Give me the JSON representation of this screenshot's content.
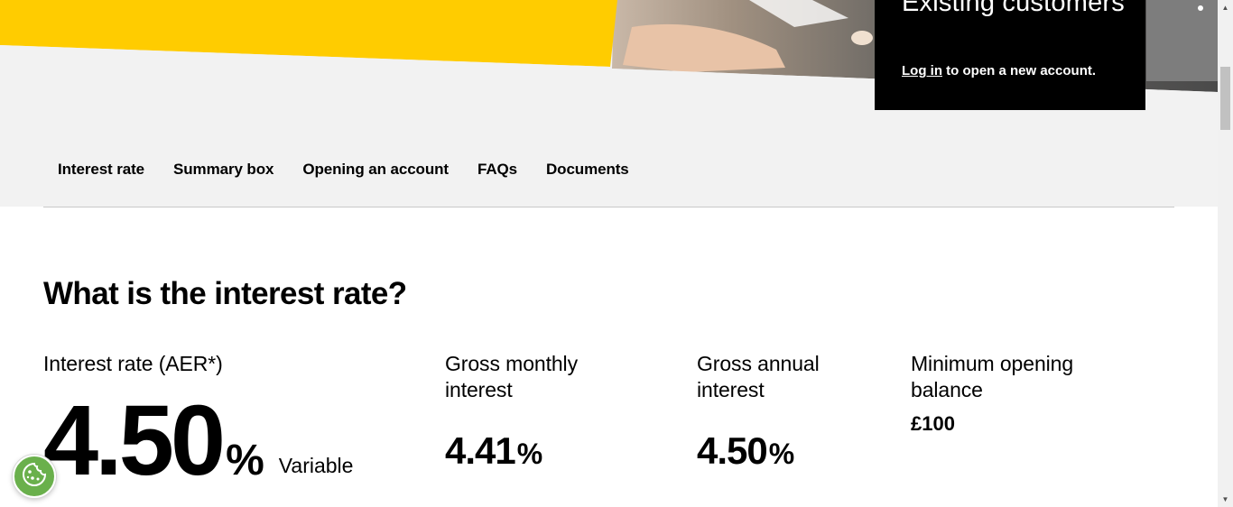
{
  "hero": {
    "existing_title": "Existing customers",
    "login_link": "Log in",
    "login_suffix": " to open a new account.",
    "accent_color": "#ffcc00"
  },
  "subnav": {
    "items": [
      {
        "label": "Interest rate"
      },
      {
        "label": "Summary box"
      },
      {
        "label": "Opening an account"
      },
      {
        "label": "FAQs"
      },
      {
        "label": "Documents"
      }
    ]
  },
  "section": {
    "title": "What is the interest rate?"
  },
  "rates": {
    "aer_label": "Interest rate (AER*)",
    "aer_value": "4.50",
    "aer_unit": "%",
    "aer_type": "Variable",
    "monthly_label": "Gross monthly interest",
    "monthly_value": "4.41",
    "monthly_unit": "%",
    "annual_label": "Gross annual interest",
    "annual_value": "4.50",
    "annual_unit": "%",
    "min_label": "Minimum opening balance",
    "min_value": "£100"
  },
  "cookie": {
    "icon": "cookie-icon",
    "color": "#6ab04c"
  },
  "scrollbar": {
    "up_icon": "▲",
    "down_icon": "▼"
  }
}
